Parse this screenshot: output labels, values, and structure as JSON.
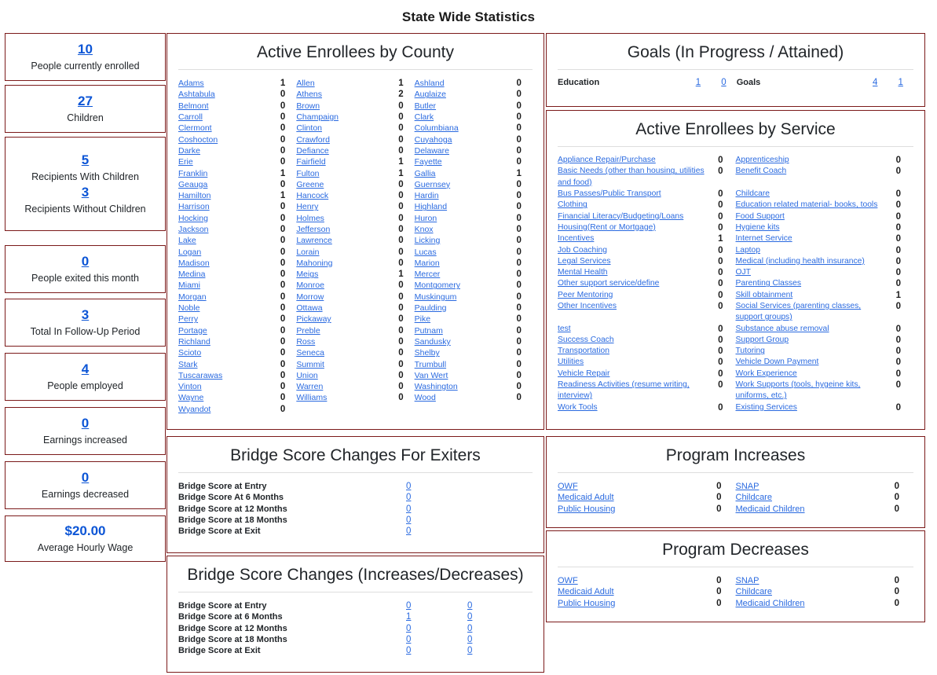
{
  "page": {
    "title": "State Wide Statistics",
    "accent": "#7b1a1a",
    "link_color": "#2a6ae0",
    "stat_color": "#0c55d6"
  },
  "stats": [
    {
      "value": "10",
      "label": "People currently enrolled",
      "linked": true
    },
    {
      "value": "27",
      "label": "Children",
      "linked": true
    },
    {
      "value": "5",
      "label": "Recipients With Children",
      "linked": true
    },
    {
      "value": "3",
      "label": "Recipients Without Children",
      "linked": true
    },
    {
      "value": "0",
      "label": "People exited this month",
      "linked": true
    },
    {
      "value": "3",
      "label": "Total In Follow-Up Period",
      "linked": true
    },
    {
      "value": "4",
      "label": "People employed",
      "linked": true
    },
    {
      "value": "0",
      "label": "Earnings increased",
      "linked": true
    },
    {
      "value": "0",
      "label": "Earnings decreased",
      "linked": true
    },
    {
      "value": "$20.00",
      "label": "Average Hourly Wage",
      "linked": false
    }
  ],
  "counties": {
    "title": "Active Enrollees by County",
    "col1": [
      {
        "name": "Adams",
        "value": "1"
      },
      {
        "name": "Ashtabula",
        "value": "0"
      },
      {
        "name": "Belmont",
        "value": "0"
      },
      {
        "name": "Carroll",
        "value": "0"
      },
      {
        "name": "Clermont",
        "value": "0"
      },
      {
        "name": "Coshocton",
        "value": "0"
      },
      {
        "name": "Darke",
        "value": "0"
      },
      {
        "name": "Erie",
        "value": "0"
      },
      {
        "name": "Franklin",
        "value": "1"
      },
      {
        "name": "Geauga",
        "value": "0"
      },
      {
        "name": "Hamilton",
        "value": "1"
      },
      {
        "name": "Harrison",
        "value": "0"
      },
      {
        "name": "Hocking",
        "value": "0"
      },
      {
        "name": "Jackson",
        "value": "0"
      },
      {
        "name": "Lake",
        "value": "0"
      },
      {
        "name": "Logan",
        "value": "0"
      },
      {
        "name": "Madison",
        "value": "0"
      },
      {
        "name": "Medina",
        "value": "0"
      },
      {
        "name": "Miami",
        "value": "0"
      },
      {
        "name": "Morgan",
        "value": "0"
      },
      {
        "name": "Noble",
        "value": "0"
      },
      {
        "name": "Perry",
        "value": "0"
      },
      {
        "name": "Portage",
        "value": "0"
      },
      {
        "name": "Richland",
        "value": "0"
      },
      {
        "name": "Scioto",
        "value": "0"
      },
      {
        "name": "Stark",
        "value": "0"
      },
      {
        "name": "Tuscarawas",
        "value": "0"
      },
      {
        "name": "Vinton",
        "value": "0"
      },
      {
        "name": "Wayne",
        "value": "0"
      },
      {
        "name": "Wyandot",
        "value": "0"
      }
    ],
    "col2": [
      {
        "name": "Allen",
        "value": "1"
      },
      {
        "name": "Athens",
        "value": "2"
      },
      {
        "name": "Brown",
        "value": "0"
      },
      {
        "name": "Champaign",
        "value": "0"
      },
      {
        "name": "Clinton",
        "value": "0"
      },
      {
        "name": "Crawford",
        "value": "0"
      },
      {
        "name": "Defiance",
        "value": "0"
      },
      {
        "name": "Fairfield",
        "value": "1"
      },
      {
        "name": "Fulton",
        "value": "1"
      },
      {
        "name": "Greene",
        "value": "0"
      },
      {
        "name": "Hancock",
        "value": "0"
      },
      {
        "name": "Henry",
        "value": "0"
      },
      {
        "name": "Holmes",
        "value": "0"
      },
      {
        "name": "Jefferson",
        "value": "0"
      },
      {
        "name": "Lawrence",
        "value": "0"
      },
      {
        "name": "Lorain",
        "value": "0"
      },
      {
        "name": "Mahoning",
        "value": "0"
      },
      {
        "name": "Meigs",
        "value": "1"
      },
      {
        "name": "Monroe",
        "value": "0"
      },
      {
        "name": "Morrow",
        "value": "0"
      },
      {
        "name": "Ottawa",
        "value": "0"
      },
      {
        "name": "Pickaway",
        "value": "0"
      },
      {
        "name": "Preble",
        "value": "0"
      },
      {
        "name": "Ross",
        "value": "0"
      },
      {
        "name": "Seneca",
        "value": "0"
      },
      {
        "name": "Summit",
        "value": "0"
      },
      {
        "name": "Union",
        "value": "0"
      },
      {
        "name": "Warren",
        "value": "0"
      },
      {
        "name": "Williams",
        "value": "0"
      }
    ],
    "col3": [
      {
        "name": "Ashland",
        "value": "0"
      },
      {
        "name": "Auglaize",
        "value": "0"
      },
      {
        "name": "Butler",
        "value": "0"
      },
      {
        "name": "Clark",
        "value": "0"
      },
      {
        "name": "Columbiana",
        "value": "0"
      },
      {
        "name": "Cuyahoga",
        "value": "0"
      },
      {
        "name": "Delaware",
        "value": "0"
      },
      {
        "name": "Fayette",
        "value": "0"
      },
      {
        "name": "Gallia",
        "value": "1"
      },
      {
        "name": "Guernsey",
        "value": "0"
      },
      {
        "name": "Hardin",
        "value": "0"
      },
      {
        "name": "Highland",
        "value": "0"
      },
      {
        "name": "Huron",
        "value": "0"
      },
      {
        "name": "Knox",
        "value": "0"
      },
      {
        "name": "Licking",
        "value": "0"
      },
      {
        "name": "Lucas",
        "value": "0"
      },
      {
        "name": "Marion",
        "value": "0"
      },
      {
        "name": "Mercer",
        "value": "0"
      },
      {
        "name": "Montgomery",
        "value": "0"
      },
      {
        "name": "Muskingum",
        "value": "0"
      },
      {
        "name": "Paulding",
        "value": "0"
      },
      {
        "name": "Pike",
        "value": "0"
      },
      {
        "name": "Putnam",
        "value": "0"
      },
      {
        "name": "Sandusky",
        "value": "0"
      },
      {
        "name": "Shelby",
        "value": "0"
      },
      {
        "name": "Trumbull",
        "value": "0"
      },
      {
        "name": "Van Wert",
        "value": "0"
      },
      {
        "name": "Washington",
        "value": "0"
      },
      {
        "name": "Wood",
        "value": "0"
      }
    ]
  },
  "goals": {
    "title": "Goals (In Progress / Attained)",
    "rows": [
      {
        "label": "Education",
        "in_progress": "1",
        "attained": "0",
        "label2": "Goals",
        "in_progress2": "4",
        "attained2": "1"
      }
    ]
  },
  "services": {
    "title": "Active Enrollees by Service",
    "col1": [
      {
        "name": "Appliance Repair/Purchase",
        "value": "0"
      },
      {
        "name": "Basic Needs (other than housing, utilities and food)",
        "value": "0"
      },
      {
        "name": "Bus Passes/Public Transport",
        "value": "0"
      },
      {
        "name": "Clothing",
        "value": "0"
      },
      {
        "name": "Financial Literacy/Budgeting/Loans",
        "value": "0"
      },
      {
        "name": "Housing(Rent or Mortgage)",
        "value": "0"
      },
      {
        "name": "Incentives",
        "value": "1"
      },
      {
        "name": "Job Coaching",
        "value": "0"
      },
      {
        "name": "Legal Services",
        "value": "0"
      },
      {
        "name": "Mental Health",
        "value": "0"
      },
      {
        "name": "Other support service/define",
        "value": "0"
      },
      {
        "name": "Peer Mentoring",
        "value": "0"
      },
      {
        "name": "Other Incentives",
        "value": "0"
      },
      {
        "name": "",
        "value": ""
      },
      {
        "name": "test",
        "value": "0"
      },
      {
        "name": "Success Coach",
        "value": "0"
      },
      {
        "name": "Transportation",
        "value": "0"
      },
      {
        "name": "Utilities",
        "value": "0"
      },
      {
        "name": "Vehicle Repair",
        "value": "0"
      },
      {
        "name": "Readiness Activities (resume writing, interview)",
        "value": "0"
      },
      {
        "name": "Work Tools",
        "value": "0"
      }
    ],
    "col2": [
      {
        "name": "Apprenticeship",
        "value": "0"
      },
      {
        "name": "Benefit Coach",
        "value": "0"
      },
      {
        "name": "",
        "value": ""
      },
      {
        "name": "Childcare",
        "value": "0"
      },
      {
        "name": "Education related material- books, tools",
        "value": "0"
      },
      {
        "name": "Food Support",
        "value": "0"
      },
      {
        "name": "Hygiene kits",
        "value": "0"
      },
      {
        "name": "Internet Service",
        "value": "0"
      },
      {
        "name": "Laptop",
        "value": "0"
      },
      {
        "name": "Medical (including health insurance)",
        "value": "0"
      },
      {
        "name": "OJT",
        "value": "0"
      },
      {
        "name": "Parenting Classes",
        "value": "0"
      },
      {
        "name": "Skill obtainment",
        "value": "1"
      },
      {
        "name": "Social Services (parenting classes, support groups)",
        "value": "0"
      },
      {
        "name": "Substance abuse removal",
        "value": "0"
      },
      {
        "name": "Support Group",
        "value": "0"
      },
      {
        "name": "Tutoring",
        "value": "0"
      },
      {
        "name": "Vehicle Down Payment",
        "value": "0"
      },
      {
        "name": "Work Experience",
        "value": "0"
      },
      {
        "name": "Work Supports (tools, hygeine kits, uniforms, etc.)",
        "value": "0"
      },
      {
        "name": "Existing Services",
        "value": "0"
      }
    ]
  },
  "bridge_exiters": {
    "title": "Bridge Score Changes For Exiters",
    "rows": [
      {
        "label": "Bridge Score at Entry",
        "value": "0"
      },
      {
        "label": "Bridge Score At 6 Months",
        "value": "0"
      },
      {
        "label": "Bridge Score at 12 Months",
        "value": "0"
      },
      {
        "label": "Bridge Score at 18 Months",
        "value": "0"
      },
      {
        "label": "Bridge Score at Exit",
        "value": "0"
      }
    ]
  },
  "bridge_changes": {
    "title": "Bridge Score Changes (Increases/Decreases)",
    "rows": [
      {
        "label": "Bridge Score at Entry",
        "increases": "0",
        "decreases": "0"
      },
      {
        "label": "Bridge Score at 6 Months",
        "increases": "1",
        "decreases": "0"
      },
      {
        "label": "Bridge Score at 12 Months",
        "increases": "0",
        "decreases": "0"
      },
      {
        "label": "Bridge Score at 18 Months",
        "increases": "0",
        "decreases": "0"
      },
      {
        "label": "Bridge Score at Exit",
        "increases": "0",
        "decreases": "0"
      }
    ]
  },
  "program_increases": {
    "title": "Program Increases",
    "col1": [
      {
        "name": "OWF",
        "value": "0"
      },
      {
        "name": "Medicaid Adult",
        "value": "0"
      },
      {
        "name": "Public Housing",
        "value": "0"
      }
    ],
    "col2": [
      {
        "name": "SNAP",
        "value": "0"
      },
      {
        "name": "Childcare",
        "value": "0"
      },
      {
        "name": "Medicaid Children",
        "value": "0"
      }
    ]
  },
  "program_decreases": {
    "title": "Program Decreases",
    "col1": [
      {
        "name": "OWF",
        "value": "0"
      },
      {
        "name": "Medicaid Adult",
        "value": "0"
      },
      {
        "name": "Public Housing",
        "value": "0"
      }
    ],
    "col2": [
      {
        "name": "SNAP",
        "value": "0"
      },
      {
        "name": "Childcare",
        "value": "0"
      },
      {
        "name": "Medicaid Children",
        "value": "0"
      }
    ]
  }
}
